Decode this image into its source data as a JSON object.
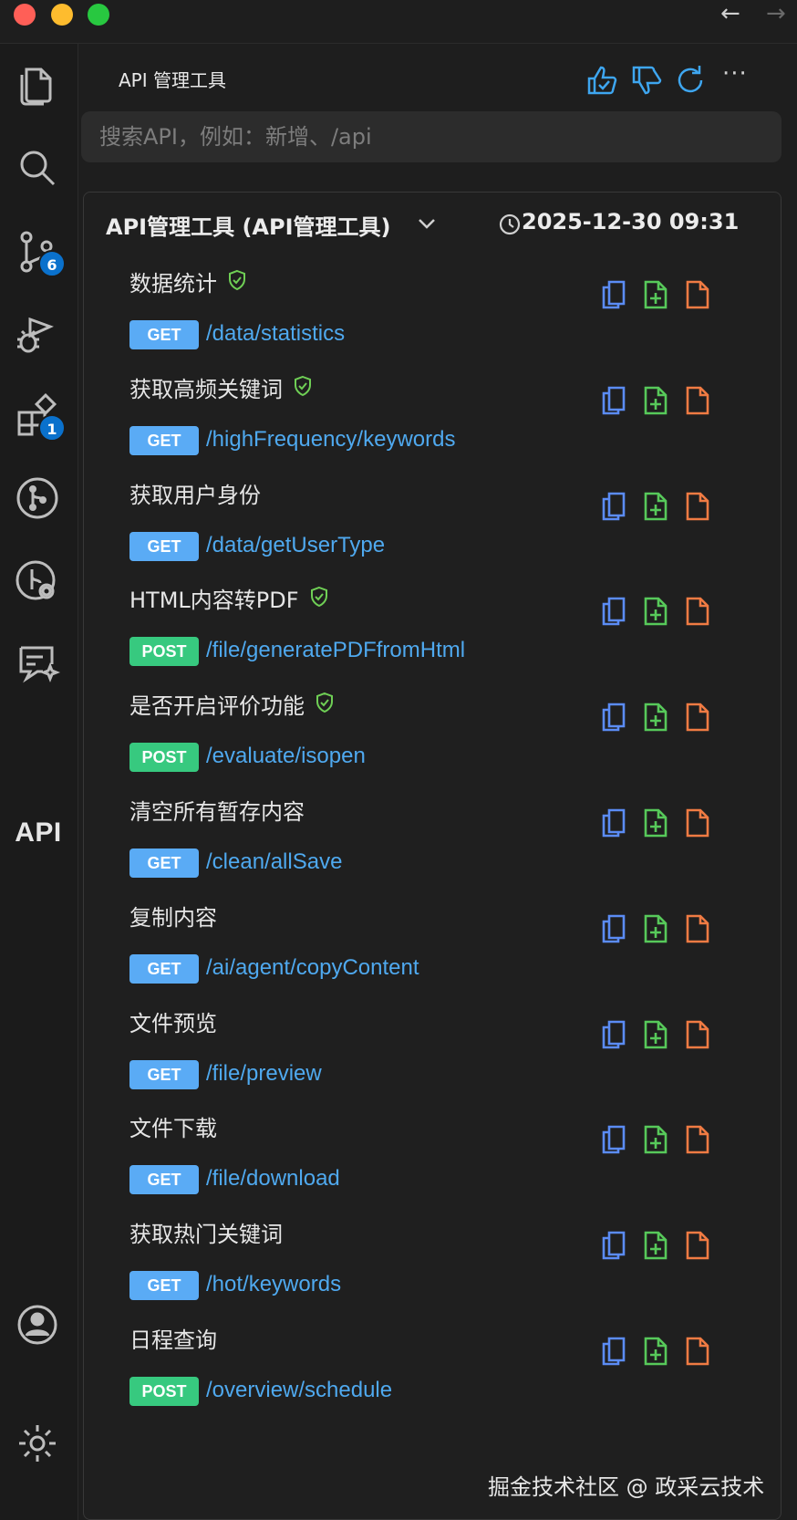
{
  "titlebar": {
    "back_icon": "arrow-left-icon",
    "forward_icon": "arrow-right-icon"
  },
  "activity_bar": {
    "items": [
      {
        "icon": "files-icon"
      },
      {
        "icon": "search-icon"
      },
      {
        "icon": "source-control-icon",
        "badge": "6"
      },
      {
        "icon": "run-debug-icon"
      },
      {
        "icon": "extensions-icon",
        "badge": "1"
      },
      {
        "icon": "git-graph-icon"
      },
      {
        "icon": "git-history-icon"
      },
      {
        "icon": "chat-sparkle-icon"
      },
      {
        "label": "API"
      },
      {
        "icon": "account-icon"
      },
      {
        "icon": "settings-gear-icon"
      }
    ]
  },
  "panel": {
    "title": "API 管理工具",
    "search_placeholder": "搜索API，例如：新增、/api",
    "group": {
      "title": "API管理工具 (API管理工具)",
      "time": "2025-12-30 09:31"
    },
    "apis": [
      {
        "name": "数据统计",
        "verified": true,
        "method": "GET",
        "path": "/data/statistics"
      },
      {
        "name": "获取高频关键词",
        "verified": true,
        "method": "GET",
        "path": "/highFrequency/keywords"
      },
      {
        "name": "获取用户身份",
        "verified": false,
        "method": "GET",
        "path": "/data/getUserType"
      },
      {
        "name": "HTML内容转PDF",
        "verified": true,
        "method": "POST",
        "path": "/file/generatePDFfromHtml"
      },
      {
        "name": "是否开启评价功能",
        "verified": true,
        "method": "POST",
        "path": "/evaluate/isopen"
      },
      {
        "name": "清空所有暂存内容",
        "verified": false,
        "method": "GET",
        "path": "/clean/allSave"
      },
      {
        "name": "复制内容",
        "verified": false,
        "method": "GET",
        "path": "/ai/agent/copyContent"
      },
      {
        "name": "文件预览",
        "verified": false,
        "method": "GET",
        "path": "/file/preview"
      },
      {
        "name": "文件下载",
        "verified": false,
        "method": "GET",
        "path": "/file/download"
      },
      {
        "name": "获取热门关键词",
        "verified": false,
        "method": "GET",
        "path": "/hot/keywords"
      },
      {
        "name": "日程查询",
        "verified": false,
        "method": "POST",
        "path": "/overview/schedule"
      }
    ]
  },
  "watermark": "掘金技术社区 @ 政采云技术",
  "colors": {
    "get": "#5aabf5",
    "post": "#37c97f",
    "path": "#4fa9ef",
    "verified": "#6fcf55",
    "copy_icon": "#5b8cf5",
    "add_icon": "#57c95a",
    "doc_icon": "#f07b43",
    "badge": "#0a71cc"
  }
}
